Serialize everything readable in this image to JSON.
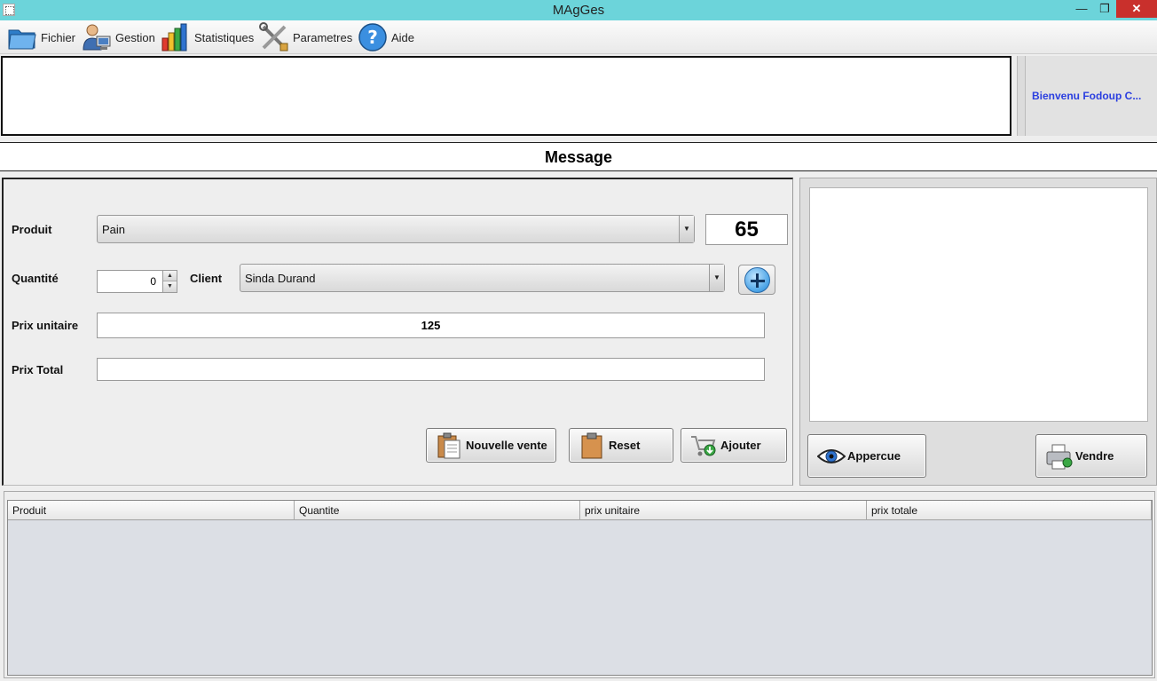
{
  "window": {
    "title": "MAgGes",
    "minimize": "—",
    "maximize": "❐",
    "close": "✕"
  },
  "menu": {
    "items": [
      {
        "label": "Fichier",
        "icon": "folder-icon"
      },
      {
        "label": "Gestion",
        "icon": "user-computer-icon"
      },
      {
        "label": "Statistiques",
        "icon": "bar-chart-icon"
      },
      {
        "label": "Parametres",
        "icon": "tools-icon"
      },
      {
        "label": "Aide",
        "icon": "help-icon"
      }
    ]
  },
  "banner": {
    "welcome": "Bienvenu Fodoup C..."
  },
  "message": {
    "title": "Message"
  },
  "form": {
    "produit_label": "Produit",
    "produit_value": "Pain",
    "stock_value": "65",
    "quantite_label": "Quantité",
    "quantite_value": "0",
    "client_label": "Client",
    "client_value": "Sinda Durand",
    "prix_unitaire_label": "Prix unitaire",
    "prix_unitaire_value": "125",
    "prix_total_label": "Prix Total",
    "prix_total_value": ""
  },
  "buttons": {
    "nouvelle_vente": "Nouvelle vente",
    "reset": "Reset",
    "ajouter": "Ajouter",
    "appercue": "Appercue",
    "vendre": "Vendre"
  },
  "table": {
    "columns": [
      "Produit",
      "Quantite",
      "prix unitaire",
      "prix totale"
    ],
    "rows": []
  },
  "colors": {
    "titlebar": "#6cd4da",
    "close_button": "#c9302c",
    "welcome_text": "#2b3fe0"
  }
}
